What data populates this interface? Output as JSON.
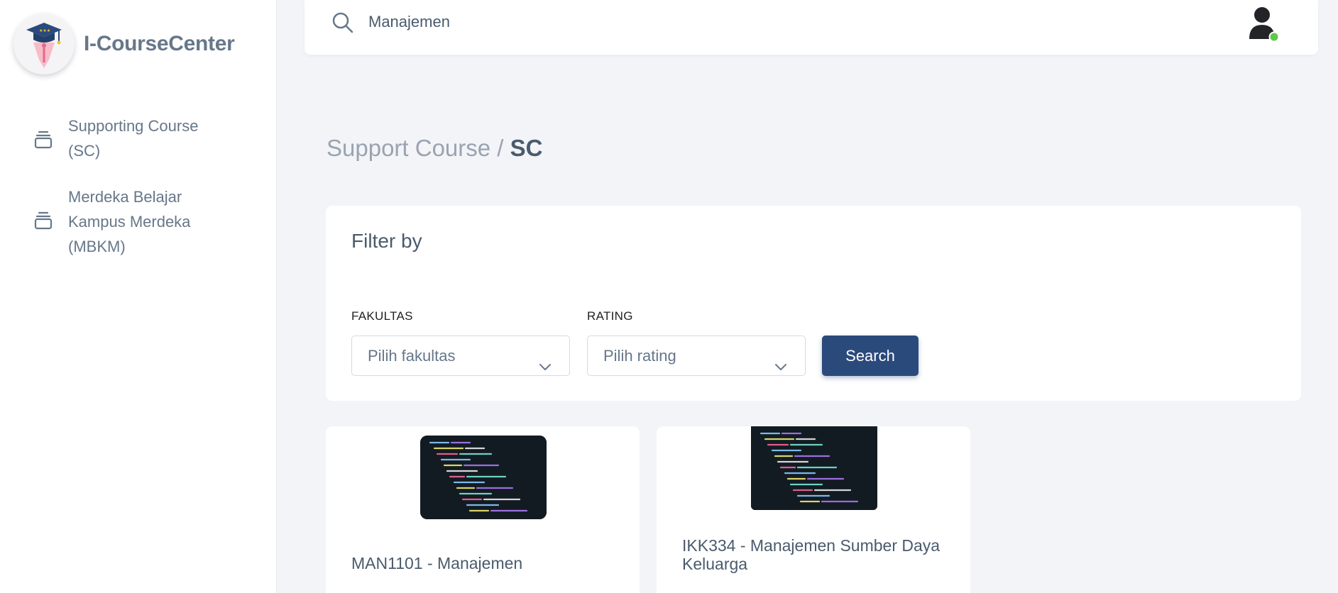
{
  "app": {
    "name": "I-CourseCenter"
  },
  "sidebar": {
    "items": [
      {
        "label": "Supporting Course (SC)"
      },
      {
        "label": "Merdeka Belajar Kampus Merdeka (MBKM)"
      }
    ]
  },
  "search": {
    "value": "Manajemen"
  },
  "breadcrumb": {
    "parent": "Support Course / ",
    "current": "SC"
  },
  "filter": {
    "title": "Filter by",
    "fakultas_label": "FAKULTAS",
    "fakultas_placeholder": "Pilih fakultas",
    "rating_label": "RATING",
    "rating_placeholder": "Pilih rating",
    "search_button": "Search"
  },
  "courses": [
    {
      "title": "MAN1101 - Manajemen"
    },
    {
      "title": "IKK334 - Manajemen Sumber Daya Keluarga"
    }
  ],
  "colors": {
    "primary": "#2b4a7c",
    "background": "#f3f4f8",
    "text": "#4a5b6d",
    "online": "#5cc94a"
  }
}
